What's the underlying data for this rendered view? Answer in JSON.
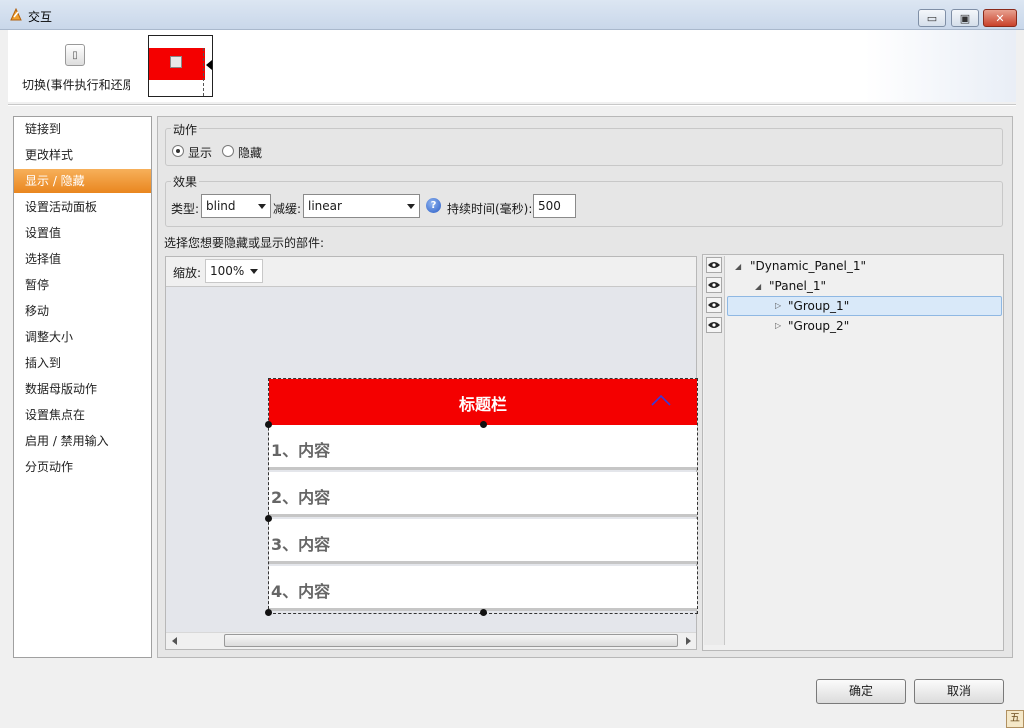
{
  "window": {
    "title": "交互",
    "controls": {
      "minimize": "▭",
      "maximize": "▣",
      "close": "✕"
    }
  },
  "toolbar": {
    "toggle_label": "切换(事件执行和还原",
    "toggle_icon": "toggle-switch-icon"
  },
  "left_nav": {
    "items": [
      "链接到",
      "更改样式",
      "显示 / 隐藏",
      "设置活动面板",
      "设置值",
      "选择值",
      "暂停",
      "移动",
      "调整大小",
      "插入到",
      "数据母版动作",
      "设置焦点在",
      "启用 / 禁用输入",
      "分页动作"
    ],
    "active_index": 2
  },
  "action": {
    "legend": "动作",
    "show_label": "显示",
    "hide_label": "隐藏",
    "selected": "show"
  },
  "effect": {
    "legend": "效果",
    "type_label": "类型:",
    "type_value": "blind",
    "easing_label": "减缓:",
    "easing_value": "linear",
    "duration_label": "持续时间(毫秒):",
    "duration_value": "500"
  },
  "widgets_prompt": "选择您想要隐藏或显示的部件:",
  "canvas": {
    "zoom_label": "缩放:",
    "zoom_value": "100%",
    "panel_title": "标题栏",
    "rows": [
      "1、内容",
      "2、内容",
      "3、内容",
      "4、内容"
    ]
  },
  "tree": {
    "nodes": [
      "\"Dynamic_Panel_1\"",
      "\"Panel_1\"",
      "\"Group_1\"",
      "\"Group_2\""
    ],
    "selected": "\"Group_1\""
  },
  "footer": {
    "ok_label": "确定",
    "cancel_label": "取消"
  },
  "colors": {
    "accent_orange": "#e9861f",
    "panel_red": "#f40000",
    "selection_blue": "#d9e9f9"
  }
}
